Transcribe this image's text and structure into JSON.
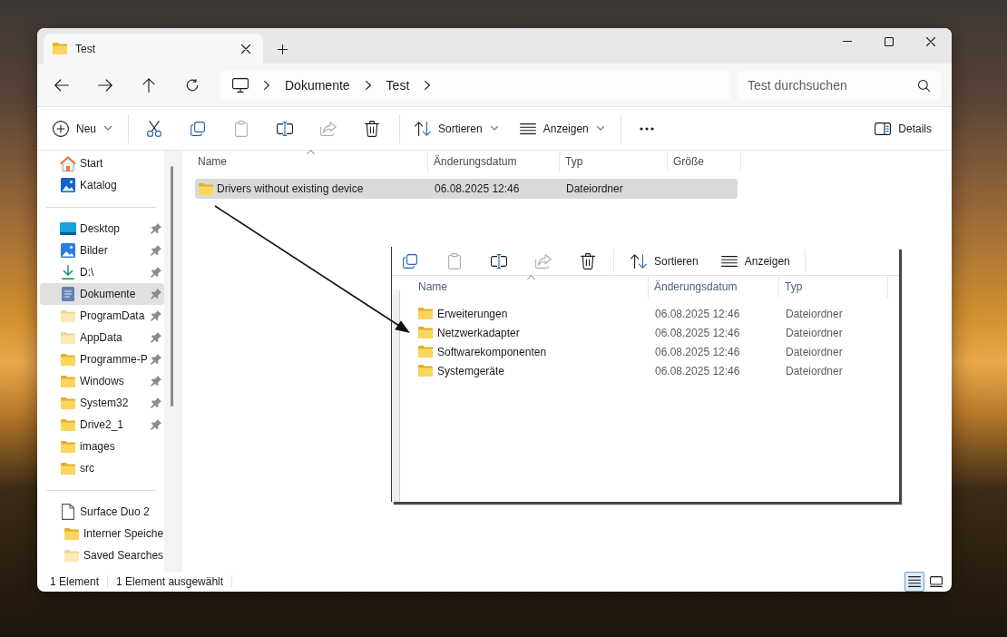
{
  "tabs": [
    {
      "title": "Test",
      "selected": true
    }
  ],
  "address_bar": {
    "segments": [
      "Dokumente",
      "Test"
    ]
  },
  "search": {
    "placeholder": "Test durchsuchen"
  },
  "toolbar": {
    "groups": [
      {
        "items": [
          {
            "kind": "new",
            "label": "Neu",
            "dropdown": true,
            "disabled": false
          }
        ]
      },
      {
        "items": [
          {
            "kind": "cut",
            "dropdown": false,
            "disabled": false
          },
          {
            "kind": "copy",
            "dropdown": false,
            "disabled": false
          },
          {
            "kind": "paste",
            "dropdown": false,
            "disabled": true
          },
          {
            "kind": "rename",
            "dropdown": false,
            "disabled": false
          },
          {
            "kind": "share",
            "dropdown": false,
            "disabled": true
          },
          {
            "kind": "delete",
            "dropdown": false,
            "disabled": false
          }
        ]
      },
      {
        "items": [
          {
            "kind": "sort",
            "label": "Sortieren",
            "dropdown": true,
            "disabled": false
          },
          {
            "kind": "view",
            "label": "Anzeigen",
            "dropdown": true,
            "disabled": false
          }
        ]
      },
      {
        "items": [
          {
            "kind": "more",
            "dropdown": false,
            "disabled": false
          }
        ]
      }
    ],
    "details_pane": {
      "label": "Details"
    }
  },
  "sidebar": {
    "sections": [
      {
        "items": [
          {
            "label": "Start",
            "kind": "home",
            "pinned": false,
            "hidden": false,
            "selected": false
          },
          {
            "label": "Katalog",
            "kind": "gallery",
            "pinned": false,
            "hidden": false,
            "selected": false
          }
        ]
      },
      {
        "items": [
          {
            "label": "Desktop",
            "kind": "desktop",
            "pinned": true,
            "hidden": false,
            "selected": false
          },
          {
            "label": "Bilder",
            "kind": "pictures",
            "pinned": true,
            "hidden": false,
            "selected": false
          },
          {
            "label": "D:\\",
            "kind": "download",
            "pinned": true,
            "hidden": false,
            "selected": false
          },
          {
            "label": "Dokumente",
            "kind": "documents",
            "pinned": true,
            "hidden": false,
            "selected": true
          },
          {
            "label": "ProgramData",
            "kind": "folder",
            "pinned": true,
            "hidden": true,
            "selected": false
          },
          {
            "label": "AppData",
            "kind": "folder",
            "pinned": true,
            "hidden": true,
            "selected": false
          },
          {
            "label": "Programme-P",
            "kind": "folder",
            "pinned": true,
            "hidden": false,
            "selected": false
          },
          {
            "label": "Windows",
            "kind": "folder",
            "pinned": true,
            "hidden": false,
            "selected": false
          },
          {
            "label": "System32",
            "kind": "folder",
            "pinned": true,
            "hidden": false,
            "selected": false
          },
          {
            "label": "Drive2_1",
            "kind": "folder",
            "pinned": true,
            "hidden": false,
            "selected": false
          },
          {
            "label": "images",
            "kind": "folder",
            "pinned": false,
            "hidden": false,
            "selected": false
          },
          {
            "label": "src",
            "kind": "folder",
            "pinned": false,
            "hidden": false,
            "selected": false
          }
        ]
      },
      {
        "items": [
          {
            "label": "Surface Duo 2",
            "kind": "device",
            "pinned": false,
            "hidden": false,
            "selected": false,
            "children": [
              {
                "label": "Interner Speiche",
                "kind": "folder",
                "pinned": false,
                "hidden": false,
                "selected": false
              },
              {
                "label": "Saved Searches",
                "kind": "folder",
                "pinned": false,
                "hidden": true,
                "selected": false
              }
            ]
          }
        ]
      }
    ]
  },
  "file_list": {
    "columns": [
      {
        "label": "Name",
        "sorted": true
      },
      {
        "label": "Änderungsdatum",
        "sorted": false
      },
      {
        "label": "Typ",
        "sorted": false
      },
      {
        "label": "Größe",
        "sorted": false
      }
    ],
    "rows": [
      {
        "name": "Drivers without existing device",
        "modified": "06.08.2025 12:46",
        "type": "Dateiordner",
        "selected": true
      }
    ]
  },
  "screenshot_inset": {
    "toolbar": {
      "groups": [
        {
          "items": [
            {
              "kind": "copy",
              "disabled": false
            },
            {
              "kind": "paste",
              "disabled": true
            },
            {
              "kind": "rename",
              "disabled": false
            },
            {
              "kind": "share",
              "disabled": true
            },
            {
              "kind": "delete",
              "disabled": false
            }
          ]
        },
        {
          "items": [
            {
              "kind": "sort",
              "label": "Sortieren",
              "disabled": false
            },
            {
              "kind": "view",
              "label": "Anzeigen",
              "disabled": false
            }
          ]
        }
      ]
    },
    "columns": [
      {
        "label": "Name",
        "sorted": true
      },
      {
        "label": "Änderungsdatum",
        "sorted": false
      },
      {
        "label": "Typ",
        "sorted": false
      }
    ],
    "rows": [
      {
        "name": "Erweiterungen",
        "modified": "06.08.2025 12:46",
        "type": "Dateiordner",
        "selected": false
      },
      {
        "name": "Netzwerkadapter",
        "modified": "06.08.2025 12:46",
        "type": "Dateiordner",
        "selected": false
      },
      {
        "name": "Softwarekomponenten",
        "modified": "06.08.2025 12:46",
        "type": "Dateiordner",
        "selected": false
      },
      {
        "name": "Systemgeräte",
        "modified": "06.08.2025 12:46",
        "type": "Dateiordner",
        "selected": false
      }
    ]
  },
  "status_bar": {
    "item_count": "1 Element",
    "selection_info": "1 Element ausgewählt",
    "views": [
      {
        "kind": "details",
        "selected": true
      },
      {
        "kind": "tiles",
        "selected": false
      }
    ]
  }
}
